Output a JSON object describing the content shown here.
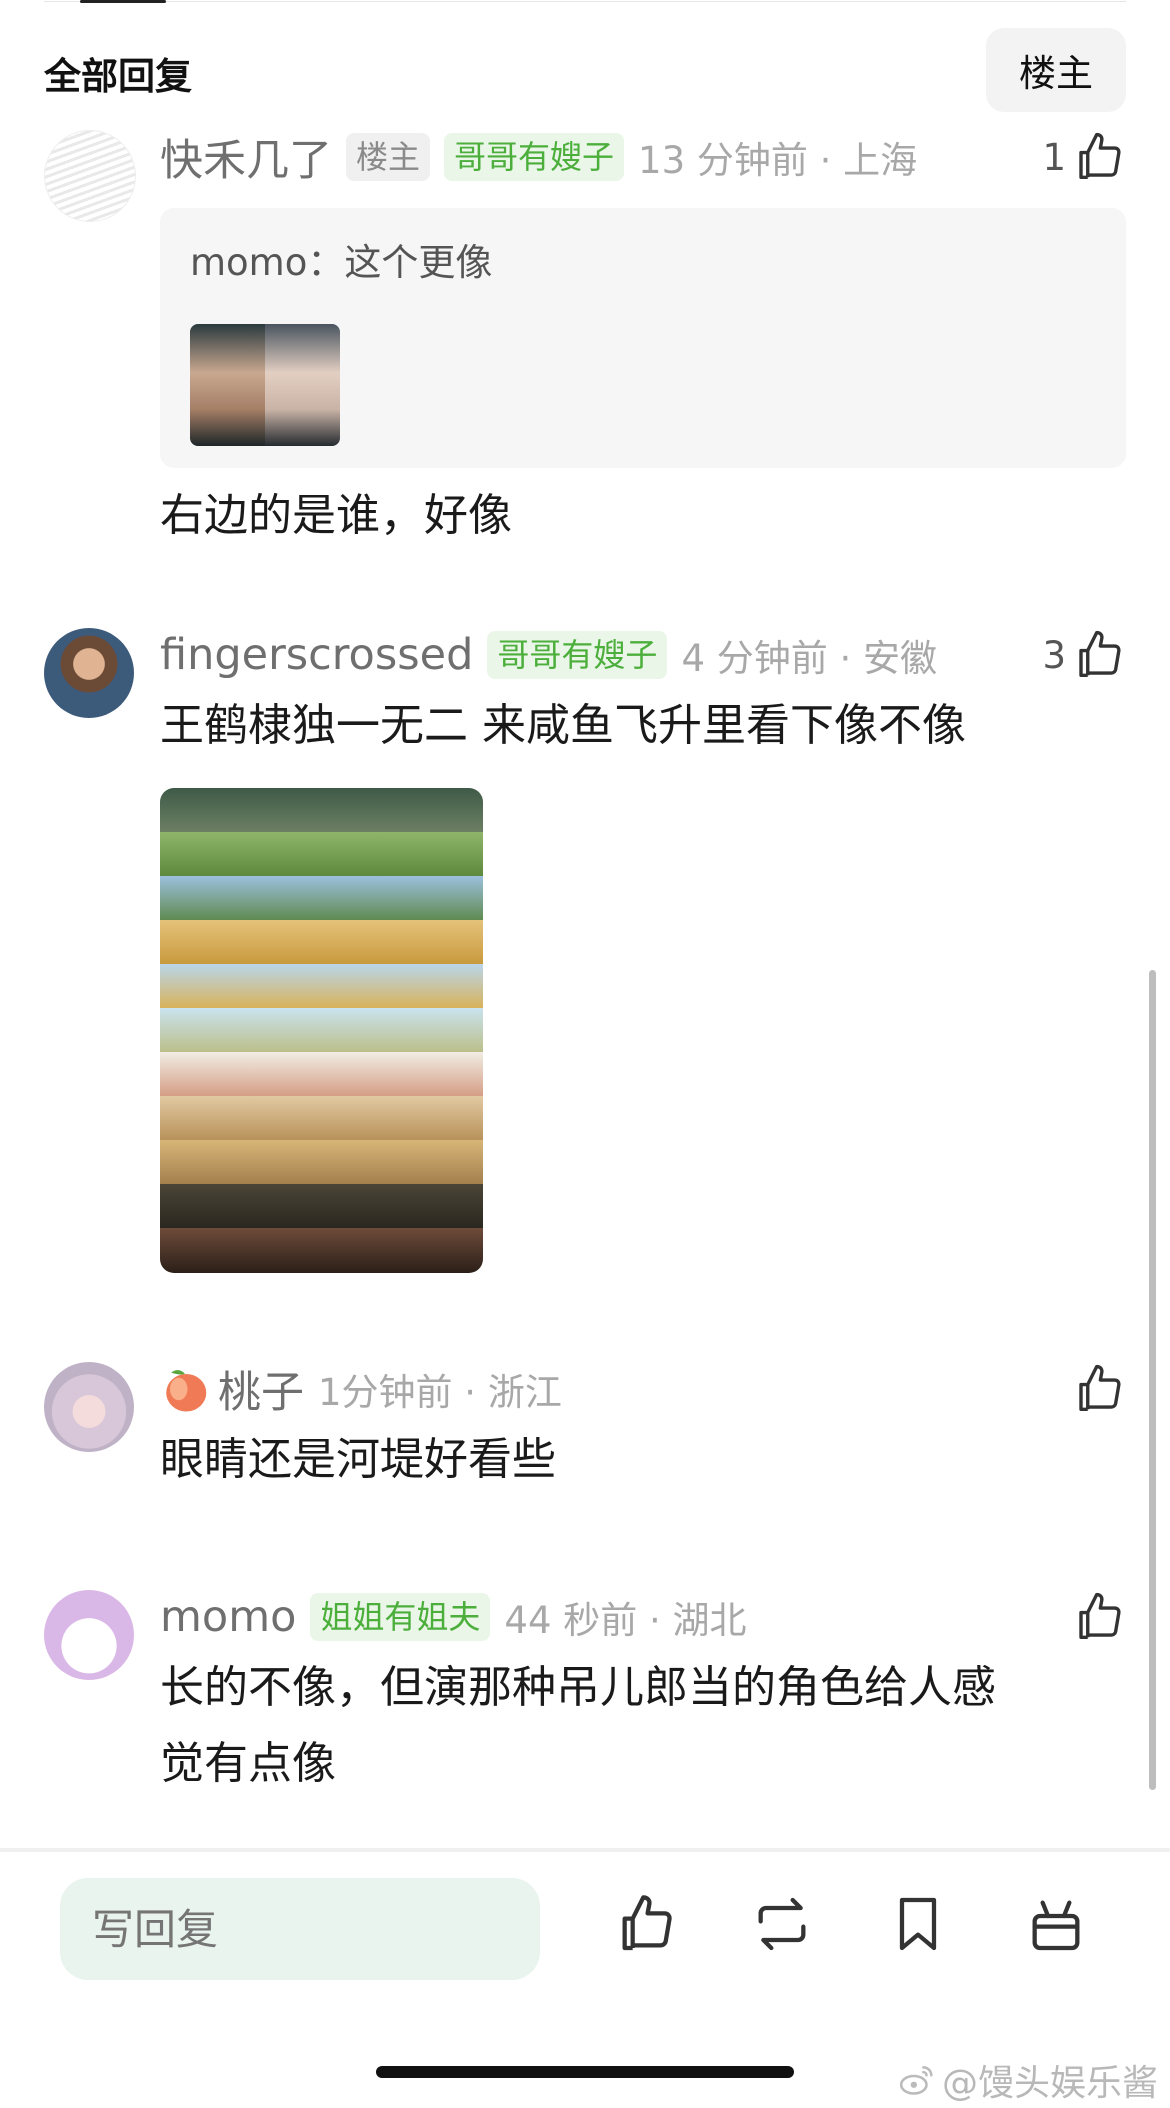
{
  "header": {
    "title": "全部回复",
    "owner_button": "楼主"
  },
  "comments": [
    {
      "name": "快禾几了",
      "owner_tag": "楼主",
      "badge": "哥哥有嫂子",
      "time": "13 分钟前 · 上海",
      "likes": "1",
      "quote": {
        "text": "momo：这个更像"
      },
      "content": "右边的是谁，好像"
    },
    {
      "name": "fingerscrossed",
      "badge": "哥哥有嫂子",
      "time": "4 分钟前 · 安徽",
      "likes": "3",
      "content": "王鹤棣独一无二 来咸鱼飞升里看下像不像"
    },
    {
      "name": "桃子",
      "time": "1分钟前 · 浙江",
      "content": "眼睛还是河堤好看些"
    },
    {
      "name": "momo",
      "badge": "姐姐有姐夫",
      "time": "44 秒前 · 湖北",
      "content_line1": "长的不像，但演那种吊儿郎当的角色给人感",
      "content_line2": "觉有点像"
    }
  ],
  "bottom_bar": {
    "reply_placeholder": "写回复"
  },
  "watermark": "@馒头娱乐酱"
}
